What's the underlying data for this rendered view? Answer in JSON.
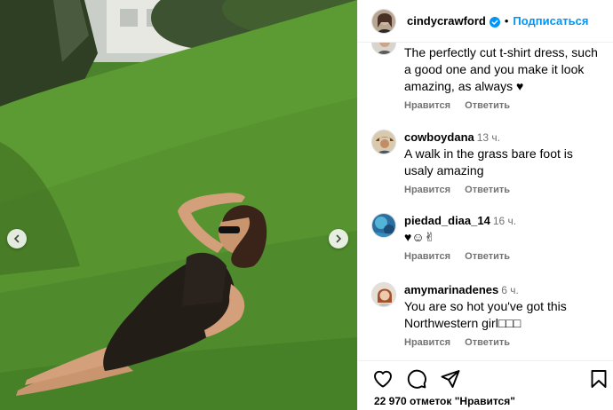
{
  "post": {
    "author": "cindycrawford",
    "follow_label": "Подписаться",
    "dot": "•",
    "likes_text": "22 970 отметок \"Нравится\""
  },
  "colors": {
    "link_blue": "#0095f6",
    "meta_gray": "#737373",
    "grass_green": "#5c9b33"
  },
  "comments": [
    {
      "user": "",
      "time": "",
      "text": "The perfectly cut t-shirt dress, such a good one and you make it look amazing, as always ♥",
      "like_label": "Нравится",
      "reply_label": "Ответить"
    },
    {
      "user": "cowboydana",
      "time": "13 ч.",
      "text": "A walk in the grass bare foot is usaly amazing",
      "like_label": "Нравится",
      "reply_label": "Ответить"
    },
    {
      "user": "piedad_diaa_14",
      "time": "16 ч.",
      "text": "♥☺✌",
      "like_label": "Нравится",
      "reply_label": "Ответить"
    },
    {
      "user": "amymarinadenes",
      "time": "6 ч.",
      "text": "You are so hot you've got this Northwestern girl□□□",
      "like_label": "Нравится",
      "reply_label": "Ответить"
    }
  ],
  "icons": {
    "like": "heart-icon",
    "comment": "comment-icon",
    "share": "share-icon",
    "save": "bookmark-icon",
    "prev": "chevron-left-icon",
    "next": "chevron-right-icon",
    "verified": "verified-badge-icon"
  }
}
